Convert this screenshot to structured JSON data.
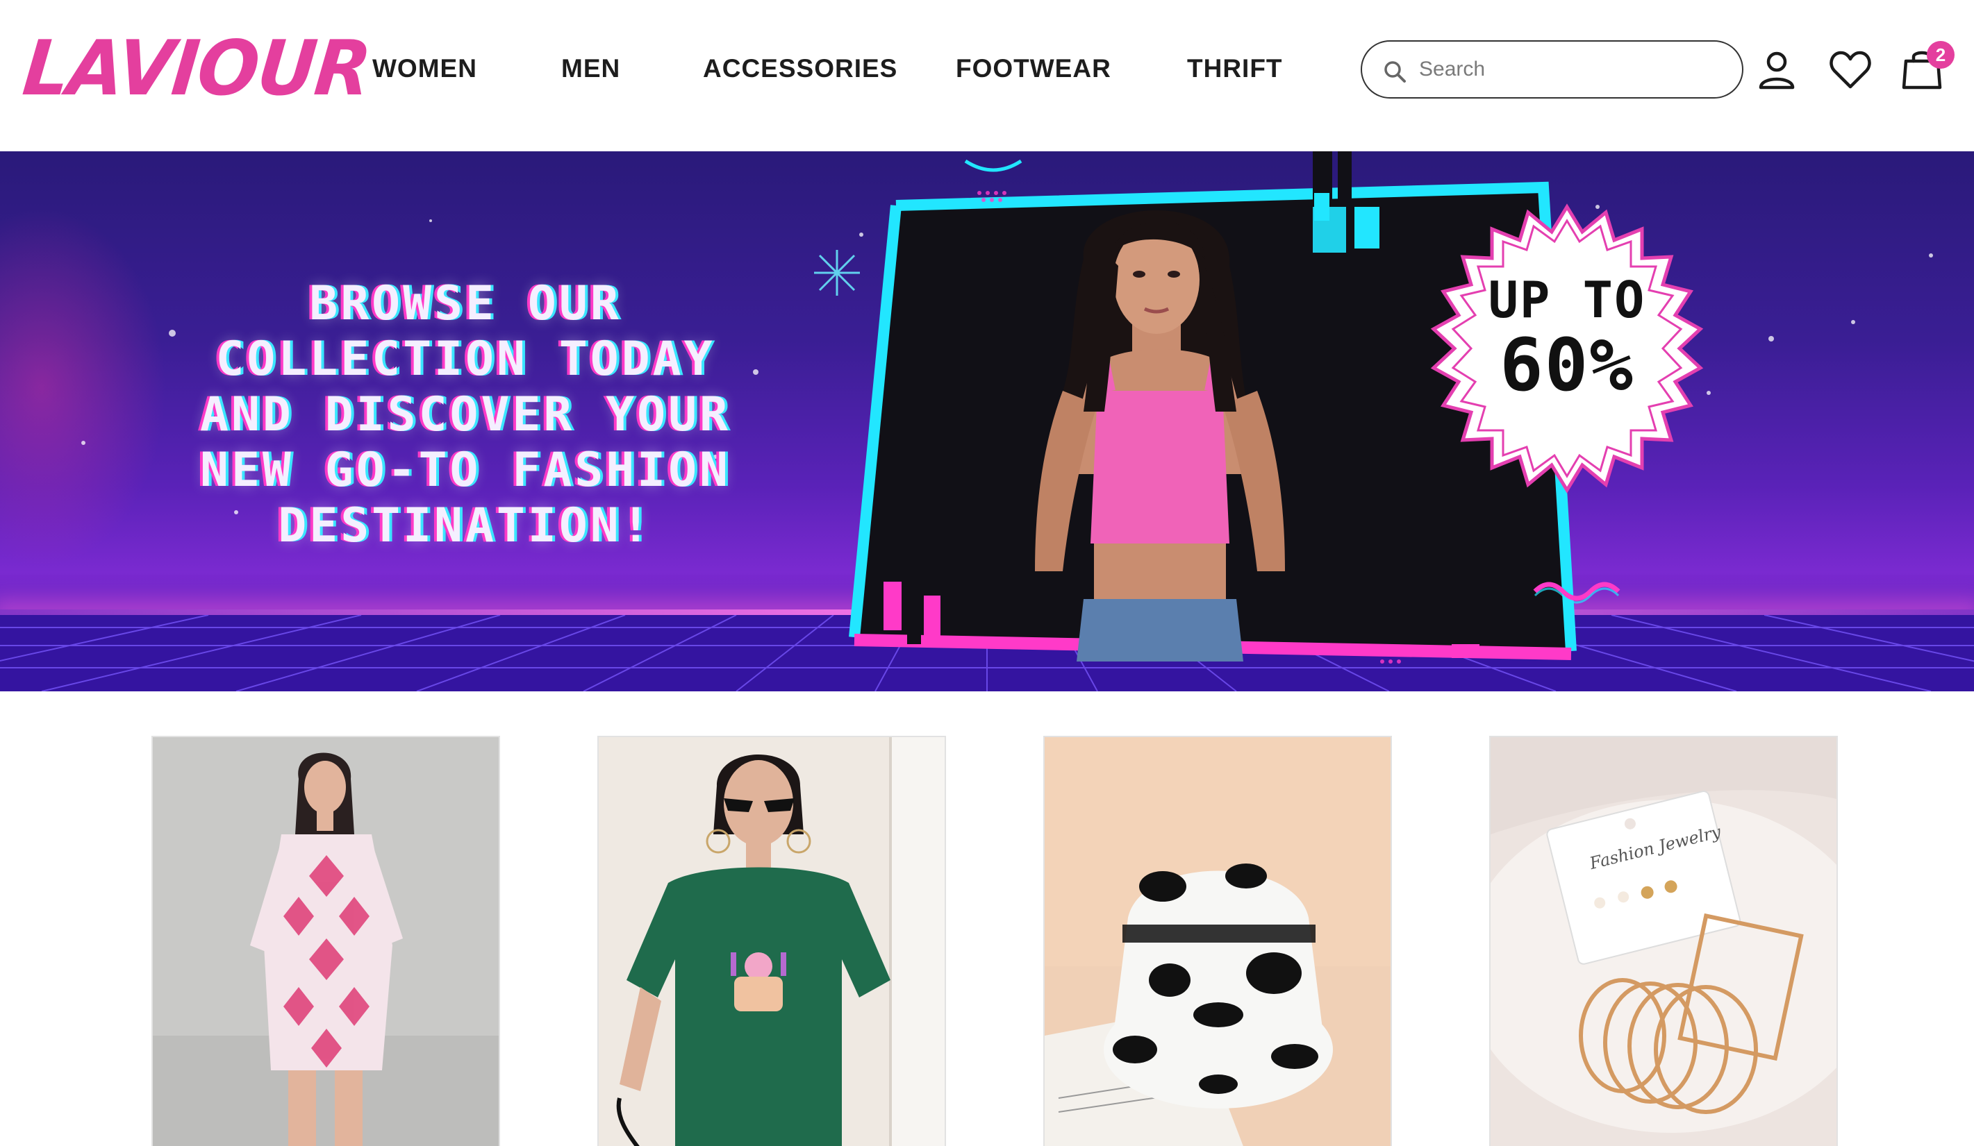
{
  "brand": {
    "logo_text": "LAVIOUR",
    "accent_color": "#e43f9e"
  },
  "nav": {
    "items": [
      {
        "label": "WOMEN"
      },
      {
        "label": "MEN"
      },
      {
        "label": "ACCESSORIES"
      },
      {
        "label": "FOOTWEAR"
      },
      {
        "label": "THRIFT"
      }
    ]
  },
  "search": {
    "placeholder": "Search",
    "value": ""
  },
  "header_icons": {
    "account_icon": "user-icon",
    "wishlist_icon": "heart-icon",
    "cart_icon": "shopping-bag-icon",
    "cart_count": "2"
  },
  "hero": {
    "headline_lines": [
      "BROWSE OUR",
      "COLLECTION TODAY",
      "AND DISCOVER YOUR",
      "NEW GO-TO FASHION",
      "DESTINATION!"
    ],
    "promo_line1": "UP TO",
    "promo_line2": "60%",
    "colors": {
      "background": "#3a1e94",
      "neon_cyan": "#22e6ff",
      "neon_pink": "#ff3ac8"
    }
  },
  "products": [
    {
      "image": "pink-patterned-shirt-dress-photo"
    },
    {
      "image": "green-graphic-tshirt-photo"
    },
    {
      "image": "cow-print-bucket-hat-photo"
    },
    {
      "image": "gold-hoop-earrings-set-photo"
    }
  ]
}
